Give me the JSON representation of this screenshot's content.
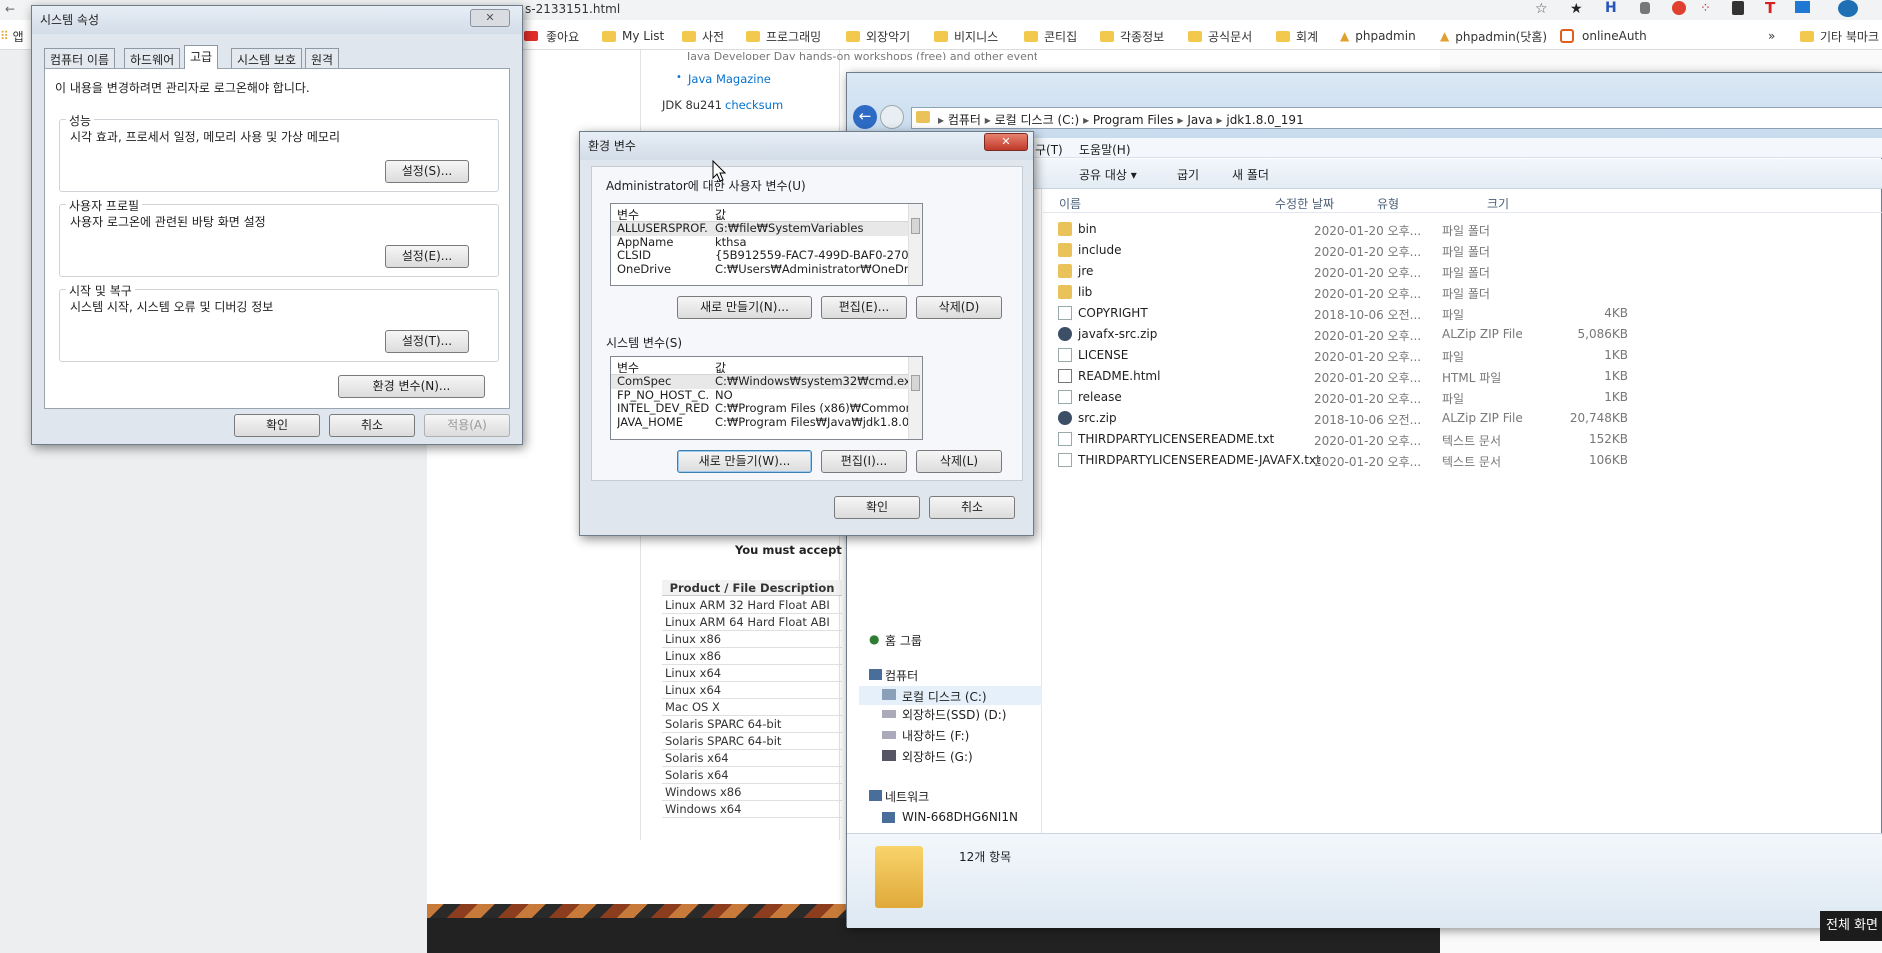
{
  "browser": {
    "tab_text": "s-2133151.html",
    "bookmarks": [
      "좋아요",
      "My List",
      "사전",
      "프로그래밍",
      "외장악기",
      "비지니스",
      "콘티집",
      "각종정보",
      "공식문서",
      "회계",
      "phpadmin",
      "phpadmin(닷홈)",
      "onlineAuth",
      "기타 북마크"
    ],
    "more": "»",
    "apps_stub": "앱"
  },
  "webpage": {
    "link_java_magazine": "Java Magazine",
    "jdk_checksum_prefix": "JDK 8u241",
    "jdk_checksum_link": "checksum",
    "top_partial": "Java Developer Day hands-on workshops (free) and other events",
    "license_text": "You must accept th",
    "table_header": "Product / File Description",
    "products": [
      "Linux ARM 32 Hard Float ABI",
      "Linux ARM 64 Hard Float ABI",
      "Linux x86",
      "Linux x86",
      "Linux x64",
      "Linux x64",
      "Mac OS X",
      "Solaris SPARC 64-bit",
      "Solaris SPARC 64-bit",
      "Solaris x64",
      "Solaris x64",
      "Windows x86",
      "Windows x64"
    ]
  },
  "sysprops": {
    "title": "시스템 속성",
    "tabs": [
      "컴퓨터 이름",
      "하드웨어",
      "고급",
      "시스템 보호",
      "원격"
    ],
    "notice": "이 내용을 변경하려면 관리자로 로그온해야 합니다.",
    "perf_title": "성능",
    "perf_desc": "시각 효과, 프로세서 일정, 메모리 사용 및 가상 메모리",
    "perf_btn": "설정(S)...",
    "profile_title": "사용자 프로필",
    "profile_desc": "사용자 로그온에 관련된 바탕 화면 설정",
    "profile_btn": "설정(E)...",
    "startup_title": "시작 및 복구",
    "startup_desc": "시스템 시작, 시스템 오류 및 디버깅 정보",
    "startup_btn": "설정(T)...",
    "env_btn": "환경 변수(N)...",
    "ok": "확인",
    "cancel": "취소",
    "apply": "적용(A)"
  },
  "envvars": {
    "title": "환경 변수",
    "user_section": "Administrator에 대한 사용자 변수(U)",
    "col_var": "변수",
    "col_val": "값",
    "user_vars": [
      {
        "name": "ALLUSERSPROF...",
        "value": "G:₩file₩SystemVariables"
      },
      {
        "name": "AppName",
        "value": "kthsa"
      },
      {
        "name": "CLSID",
        "value": "{5B912559-FAC7-499D-BAF0-270BDA5BB..."
      },
      {
        "name": "OneDrive",
        "value": "C:₩Users₩Administrator₩OneDrive"
      }
    ],
    "user_new": "새로 만들기(N)...",
    "user_edit": "편집(E)...",
    "user_delete": "삭제(D)",
    "sys_section": "시스템 변수(S)",
    "sys_vars": [
      {
        "name": "ComSpec",
        "value": "C:₩Windows₩system32₩cmd.exe"
      },
      {
        "name": "FP_NO_HOST_C...",
        "value": "NO"
      },
      {
        "name": "INTEL_DEV_RED...",
        "value": "C:₩Program Files (x86)₩Common Files..."
      },
      {
        "name": "JAVA_HOME",
        "value": "C:₩Program Files₩Java₩jdk1.8.0_191"
      }
    ],
    "sys_new": "새로 만들기(W)...",
    "sys_edit": "편집(I)...",
    "sys_delete": "삭제(L)",
    "ok": "확인",
    "cancel": "취소"
  },
  "explorer": {
    "breadcrumb": [
      "컴퓨터",
      "로컬 디스크 (C:)",
      "Program Files",
      "Java",
      "jdk1.8.0_191"
    ],
    "menu_partial": "구(T)",
    "menu_help": "도움말(H)",
    "toolbar_share": "공유 대상 ▾",
    "toolbar_burn": "굽기",
    "toolbar_newfolder": "새 폴더",
    "col_name": "이름",
    "col_date": "수정한 날짜",
    "col_type": "유형",
    "col_size": "크기",
    "files": [
      {
        "name": "bin",
        "date": "2020-01-20 오후...",
        "type": "파일 폴더",
        "size": "",
        "icon": "folder"
      },
      {
        "name": "include",
        "date": "2020-01-20 오후...",
        "type": "파일 폴더",
        "size": "",
        "icon": "folder"
      },
      {
        "name": "jre",
        "date": "2020-01-20 오후...",
        "type": "파일 폴더",
        "size": "",
        "icon": "folder"
      },
      {
        "name": "lib",
        "date": "2020-01-20 오후...",
        "type": "파일 폴더",
        "size": "",
        "icon": "folder"
      },
      {
        "name": "COPYRIGHT",
        "date": "2018-10-06 오전...",
        "type": "파일",
        "size": "4KB",
        "icon": "file"
      },
      {
        "name": "javafx-src.zip",
        "date": "2020-01-20 오후...",
        "type": "ALZip ZIP File",
        "size": "5,086KB",
        "icon": "zip"
      },
      {
        "name": "LICENSE",
        "date": "2020-01-20 오후...",
        "type": "파일",
        "size": "1KB",
        "icon": "file"
      },
      {
        "name": "README.html",
        "date": "2020-01-20 오후...",
        "type": "HTML 파일",
        "size": "1KB",
        "icon": "html"
      },
      {
        "name": "release",
        "date": "2020-01-20 오후...",
        "type": "파일",
        "size": "1KB",
        "icon": "file"
      },
      {
        "name": "src.zip",
        "date": "2018-10-06 오전...",
        "type": "ALZip ZIP File",
        "size": "20,748KB",
        "icon": "zip"
      },
      {
        "name": "THIRDPARTYLICENSEREADME.txt",
        "date": "2020-01-20 오후...",
        "type": "텍스트 문서",
        "size": "152KB",
        "icon": "file"
      },
      {
        "name": "THIRDPARTYLICENSEREADME-JAVAFX.txt",
        "date": "2020-01-20 오후...",
        "type": "텍스트 문서",
        "size": "106KB",
        "icon": "file"
      }
    ],
    "nav": {
      "homegroup": "홈 그룹",
      "computer": "컴퓨터",
      "drives": [
        "로컬 디스크 (C:)",
        "외장하드(SSD) (D:)",
        "내장하드 (F:)",
        "외장하드 (G:)"
      ],
      "network": "네트워크",
      "pc": "WIN-668DHG6NI1N"
    },
    "status_count": "12개 항목"
  },
  "fullscreen_tip": "전체 화면"
}
